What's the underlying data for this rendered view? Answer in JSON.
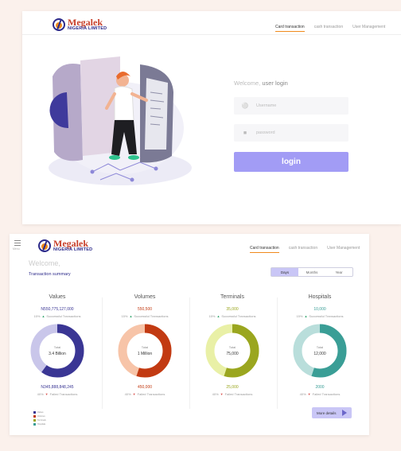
{
  "brand": {
    "name": "Megalek",
    "subtitle": "NIGERIA LIMITED"
  },
  "nav": [
    "Card transaction",
    "cash transaction",
    "User Management"
  ],
  "login": {
    "welcome": "Welcome,",
    "welcome_sub": "user login",
    "username_placeholder": "Username",
    "password_placeholder": "password",
    "button": "login"
  },
  "dashboard": {
    "menu_label": "Menu",
    "welcome": "Welcome,",
    "summary": "Transaction summary",
    "periods": [
      "Days",
      "Months",
      "Year"
    ],
    "active_period": "Days",
    "nav": [
      "Card transaction",
      "cash transaction",
      "User Management"
    ],
    "cards": [
      {
        "title": "Values",
        "top_value": "N550,775,127,000",
        "top_pct": "15%",
        "top_label": "Successful Transactions",
        "total_label": "Total",
        "total_value": "3.4 Billion",
        "bottom_value": "N345,888,848,245",
        "bottom_pct": "40%",
        "bottom_label": "Failed Transactions",
        "success_fraction": 0.6,
        "color_main": "#3a3694",
        "color_light": "#c9c6ea",
        "amount_color": "#3a3694"
      },
      {
        "title": "Volumes",
        "top_value": "550,500",
        "top_pct": "15%",
        "top_label": "Successful Transactions",
        "total_label": "Total",
        "total_value": "1 Million",
        "bottom_value": "450,000",
        "bottom_pct": "40%",
        "bottom_label": "Failed Transactions",
        "success_fraction": 0.55,
        "color_main": "#c23a12",
        "color_light": "#f7c4a8",
        "amount_color": "#c23a12"
      },
      {
        "title": "Terminals",
        "top_value": "35,000",
        "top_pct": "15%",
        "top_label": "Successful Transactions",
        "total_label": "Total",
        "total_value": "75,000",
        "bottom_value": "25,000",
        "bottom_pct": "40%",
        "bottom_label": "Failed Transactions",
        "success_fraction": 0.55,
        "color_main": "#9aa61f",
        "color_light": "#e9f0a6",
        "amount_color": "#9aa61f"
      },
      {
        "title": "Hospitals",
        "top_value": "10,000",
        "top_pct": "15%",
        "top_label": "Successful Transactions",
        "total_label": "Total",
        "total_value": "12,000",
        "bottom_value": "2000",
        "bottom_pct": "40%",
        "bottom_label": "Failed Transactions",
        "success_fraction": 0.55,
        "color_main": "#3a9e96",
        "color_light": "#b9dedb",
        "amount_color": "#3a9e96"
      }
    ],
    "legend": [
      {
        "label": "Values",
        "color": "#3a3694"
      },
      {
        "label": "Volumes",
        "color": "#c23a12"
      },
      {
        "label": "Terminals",
        "color": "#9aa61f"
      },
      {
        "label": "Hospitals",
        "color": "#3a9e96"
      }
    ],
    "more_details": "More details"
  }
}
